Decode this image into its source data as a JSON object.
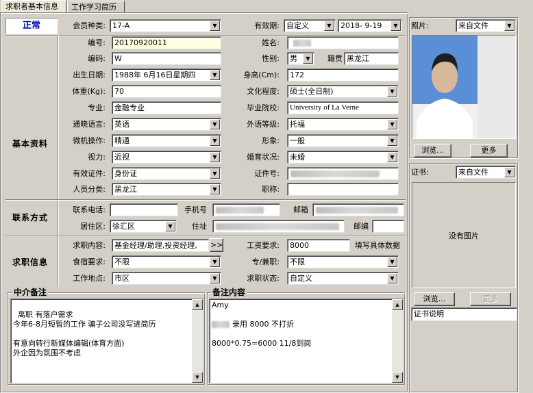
{
  "tabs": [
    "求职者基本信息",
    "工作学习简历"
  ],
  "status": "正常",
  "member_type": {
    "label": "会员种类:",
    "value": "17-A"
  },
  "validity": {
    "label": "有效期:",
    "type": "自定义",
    "date": "2018- 9-19"
  },
  "photo": {
    "label": "照片:",
    "source": "来自文件",
    "browse": "浏览...",
    "more": "更多"
  },
  "sections": {
    "basic": "基本资料",
    "contact": "联系方式",
    "job": "求职信息"
  },
  "basic": {
    "number_label": "编号:",
    "number": "20170920011",
    "name_label": "姓名:",
    "code_label": "编码:",
    "code": "W",
    "gender_label": "性别:",
    "gender": "男",
    "native_label": "籍贯",
    "native": "黑龙江",
    "birth_label": "出生日期:",
    "birth": "1988年 6月16日星期四",
    "height_label": "身高(Cm):",
    "height": "172",
    "weight_label": "体重(Kg):",
    "weight": "70",
    "edu_label": "文化程度:",
    "edu": "硕士(全日制)",
    "major_label": "专业:",
    "major": "金融专业",
    "school_label": "毕业院校:",
    "school": "University of La Verne",
    "lang_label": "通晓语言:",
    "lang": "英语",
    "lang_level_label": "外语等级:",
    "lang_level": "托福",
    "pc_label": "微机操作:",
    "pc": "精通",
    "look_label": "形象:",
    "look": "一般",
    "vision_label": "视力:",
    "vision": "近视",
    "marital_label": "婚育状况:",
    "marital": "未婚",
    "id_type_label": "有效证件:",
    "id_type": "身份证",
    "id_no_label": "证件号:",
    "category_label": "人员分类:",
    "category": "黑龙江",
    "title_label": "职称:",
    "title": ""
  },
  "contact": {
    "phone_label": "联系电话:",
    "phone": "",
    "mobile_label": "手机号",
    "email_label": "邮箱",
    "district_label": "居住区:",
    "district": "徐汇区",
    "address_label": "住址",
    "zip_label": "邮编",
    "zip": ""
  },
  "job": {
    "content_label": "求职内容:",
    "content": "基金经理/助理,投资经理,",
    "more_btn": ">>",
    "salary_label": "工资要求:",
    "salary": "8000",
    "salary_hint": "填写具体数据",
    "board_label": "食宿要求:",
    "board": "不限",
    "parttime_label": "专/兼职:",
    "parttime": "不限",
    "location_label": "工作地点:",
    "location": "市区",
    "state_label": "求职状态:",
    "state": "自定义"
  },
  "memo_agency": {
    "title": "中介备注",
    "text": "离职 有落户需求\n今年6-8月短暂的工作 骗子公司没写进简历\n\n有意向转行新媒体编辑(体育方面)\n外企因为氛围不考虑"
  },
  "memo_notes": {
    "title": "备注内容",
    "line1": "Amy",
    "line2": "录用  8000  不打折",
    "line3": "8000*0.75=6000  11/8到岗"
  },
  "certificate": {
    "label": "证书:",
    "source": "来自文件",
    "no_image": "没有图片",
    "browse": "浏览...",
    "more": "更多",
    "desc": "证书说明"
  }
}
